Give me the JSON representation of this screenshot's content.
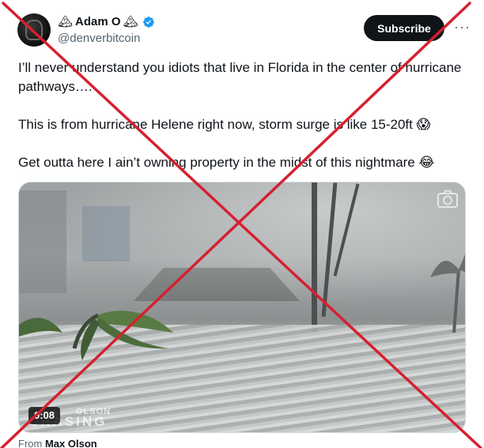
{
  "author": {
    "emoji_left": "🏔",
    "display_name": "Adam O",
    "emoji_right": "🏔",
    "handle": "@denverbitcoin",
    "verified": true
  },
  "actions": {
    "subscribe_label": "Subscribe",
    "more_label": "···"
  },
  "tweet": {
    "line1": "I’ll never understand you idiots that live in Florida in the center of hurricane pathways….",
    "line2": "This is from hurricane Helene right now, storm surge is like 15-20ft 😱",
    "line3": "Get outta here I ain’t owning property in the midst of this nightmare 😂"
  },
  "media": {
    "duration": "0:08",
    "watermark_line1": "OLSON",
    "watermark_line2": "CHASING",
    "camera_icon": "camera-icon"
  },
  "attribution": {
    "prefix": "From",
    "author": "Max Olson"
  },
  "colors": {
    "cross": "#d6202f",
    "verified": "#1d9bf0",
    "subscribe_bg": "#0f1419"
  }
}
